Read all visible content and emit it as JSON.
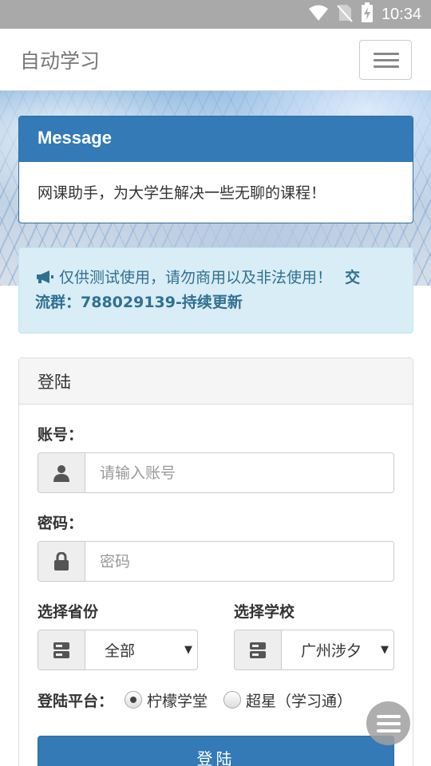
{
  "status_bar": {
    "time": "10:34",
    "icons": [
      "wifi-icon",
      "no-sim-icon",
      "battery-charging-icon"
    ]
  },
  "navbar": {
    "brand": "自动学习",
    "toggle_icon": "hamburger-icon"
  },
  "message": {
    "title": "Message",
    "body": "网课助手，为大学生解决一些无聊的课程！"
  },
  "notice": {
    "icon": "bullhorn-icon",
    "text": "仅供测试使用，请勿商用以及非法使用！",
    "group_text_line1": "交",
    "group_text_line2": "流群：788029139-持续更新"
  },
  "login": {
    "heading": "登陆",
    "account_label": "账号：",
    "account_placeholder": "请输入账号",
    "account_icon": "user-icon",
    "password_label": "密码：",
    "password_placeholder": "密码",
    "password_icon": "lock-icon",
    "province_label": "选择省份",
    "province_value": "全部",
    "school_label": "选择学校",
    "school_value": "广州涉夕",
    "select_icon": "server-icon",
    "platform_label": "登陆平台：",
    "platform_options": [
      "柠檬学堂",
      "超星（学习通）"
    ],
    "platform_selected": "柠檬学堂",
    "submit_label": "登陆"
  },
  "fab": {
    "icon": "menu-icon"
  },
  "colors": {
    "primary": "#337ab7",
    "info_bg": "#d9edf7",
    "info_text": "#31708f",
    "status_bar": "#a9a9a9"
  }
}
